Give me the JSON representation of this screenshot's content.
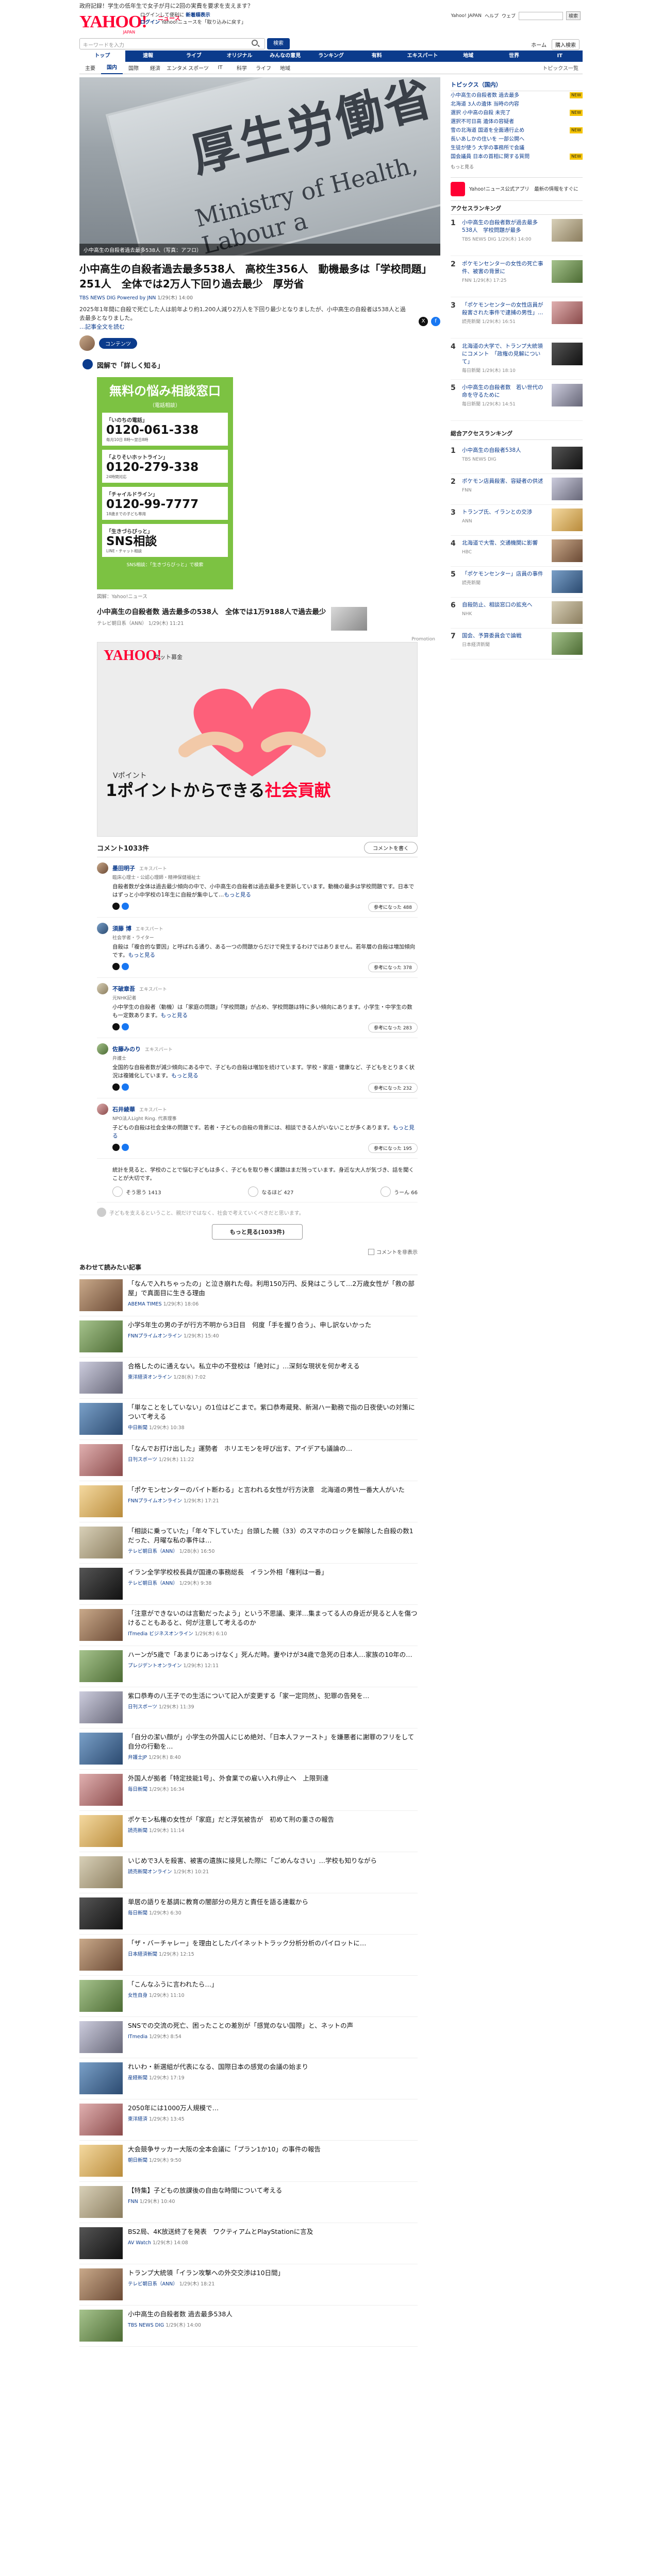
{
  "header": {
    "notice": "政府記録！学生の低年生で女子が月に2回の実費を要求を支えます？",
    "logo_text": "YAHOO!",
    "logo_sub": "JAPAN",
    "logo_news": "ニュース",
    "links_line1": "ログインして便利に",
    "links_line1_b": "新着順表示",
    "links_line2_login": "ログイン",
    "links_line2": "Yahoo!ニュースを「取り込みに戻す」",
    "right_items": [
      "Yahoo! JAPAN",
      "ヘルプ"
    ],
    "right_search_btn": "検索",
    "right_site_label": "ウェブ"
  },
  "search": {
    "placeholder": "キーワードを入力",
    "button": "検索",
    "account": "ホーム",
    "account_btn": "購入検索"
  },
  "nav_main": [
    "トップ",
    "速報",
    "ライブ",
    "オリジナル",
    "みんなの意見",
    "ランキング",
    "有料",
    "エキスパート",
    "地域",
    "世界",
    "IT"
  ],
  "nav_main_active": 0,
  "nav_sub": [
    "主要",
    "国内",
    "国際",
    "経済",
    "エンタメ",
    "スポーツ",
    "IT",
    "科学",
    "ライフ",
    "地域"
  ],
  "nav_sub_more": "トピックス一覧",
  "hero": {
    "kanji": "厚生労働省",
    "eng": "Ministry of Health, Labour a",
    "caption": "小中高生の自殺者過去最多538人（写真：アフロ）"
  },
  "article": {
    "title": "小中高生の自殺者過去最多538人　高校生356人　動機最多は「学校問題」251人　全体では2万人下回り過去最少　厚労省",
    "meta_src": "TBS NEWS DIG Powered by JNN",
    "meta_time": "1/29(木) 14:00",
    "lead": "2025年1年間に自殺で死亡した人は前年より約1,200人減り2万人を下回り最少となりましたが、小中高生の自殺者は538人と過去最多となりました。",
    "more": "…記事全文を読む"
  },
  "comm_tag": "コンテンツ",
  "zukai": "図解で「詳しく知る」",
  "poster": {
    "title": "無料の悩み相談窓口",
    "subtitle": "（電話相談）",
    "cards": [
      {
        "label": "「いのちの電話」",
        "number": "0120-061-338",
        "note": "毎月10日 8時〜翌日8時"
      },
      {
        "label": "「よりそいホットライン」",
        "number": "0120-279-338",
        "note": "24時間対応"
      },
      {
        "label": "「チャイルドライン」",
        "number": "0120-99-7777",
        "note": "18歳までの子ども専用"
      },
      {
        "label": "「生きづらびっと」",
        "number": "SNS相談",
        "note": "LINE・チャット相談"
      }
    ],
    "footer": "SNS相談：「生きづらびっと」で検索",
    "caption": "図解：Yahoo!ニュース"
  },
  "related": {
    "title": "小中高生の自殺者数 過去最多の538人　全体では1万9188人で過去最少",
    "meta": "テレビ朝日系（ANN） 1/29(木) 11:21"
  },
  "ad": {
    "label_top": "Promotion",
    "logo": "YAHOO!",
    "label": "ネット募金",
    "vp": "Vポイント",
    "line1": "1ポイントからできる",
    "line1_acc": "社会貢献"
  },
  "comments": {
    "header": "コメント1033件",
    "write_btn": "コメントを書く",
    "items": [
      {
        "name": "墨田明子",
        "badge": "エキスパート",
        "role": "臨床心理士・公認心理師・精神保健福祉士",
        "body": "自殺者数が全体は過去最少傾向の中で、小中高生の自殺者は過去最多を更新しています。動機の最多は学校問題です。日本ではずっと小中学校の1年生に自殺が集中して…",
        "more": "もっと見る",
        "likes": "参考になった 488"
      },
      {
        "name": "須藤 博",
        "badge": "エキスパート",
        "role": "社会学者・ライター",
        "body": "自殺は「複合的な要因」と呼ばれる通り、ある一つの問題からだけで発生するわけではありません。若年層の自殺は増加傾向です。",
        "more": "もっと見る",
        "likes": "参考になった 378"
      },
      {
        "name": "不破章吾",
        "badge": "エキスパート",
        "role": "元NHK記者",
        "body": "小中学生の自殺者（動機）は「家庭の問題」「学校問題」が占め、学校問題は特に多い傾向にあります。小学生・中学生の数も一定数あります。",
        "more": "もっと見る",
        "likes": "参考になった 283"
      },
      {
        "name": "佐藤みのり",
        "badge": "エキスパート",
        "role": "弁護士",
        "body": "全国的な自殺者数が減少傾向にある中で、子どもの自殺は増加を続けています。学校・家庭・健康など、子どもをとりまく状況は複雑化しています。",
        "more": "もっと見る",
        "likes": "参考になった 232"
      },
      {
        "name": "石井綾華",
        "badge": "エキスパート",
        "role": "NPO法人Light Ring. 代表理事",
        "body": "子どもの自殺は社会全体の問題です。若者・子どもの自殺の背景には、相談できる人がいないことが多くあります。",
        "more": "もっと見る",
        "likes": "参考になった 195"
      }
    ],
    "last_body": "統計を見ると、学校のことで悩む子どもは多く、子どもを取り巻く課題はまだ残っています。身近な大人が気づき、話を聞くことが大切です。",
    "stats": [
      "そう思う 1413",
      "なるほど 427",
      "うーん 66"
    ],
    "note": "子どもを支えるということ、親だけではなく、社会で考えていくべきだと思います。",
    "more_btn": "もっと見る(1033件)",
    "toggle": "コメントを非表示"
  },
  "recs": {
    "header": "あわせて読みたい記事",
    "items": [
      {
        "title": "「なんで入れちゃったの」と泣き崩れた母。利用150万円、反発はこうして…2万歳女性が「救の部屋」で真面目に生きる理由",
        "src": "ABEMA TIMES",
        "time": "1/29(木) 18:06"
      },
      {
        "title": "小学5年生の男の子が行方不明から3日目　何度「手を握り合う」、申し訳ないかった",
        "src": "FNNプライムオンライン",
        "time": "1/29(木) 15:40"
      },
      {
        "title": "合格したのに通えない。私立中の不登校は「絶対に」…深刻な現状を何か考える",
        "src": "東洋経済オンライン",
        "time": "1/28(水) 7:02"
      },
      {
        "title": "「単なことをしていない」の1位はどこまで。紫口恭寿蔵発、新潟ハー勤務で指の日夜使いの対策について考える",
        "src": "中日新聞",
        "time": "1/29(木) 10:38"
      },
      {
        "title": "「なんでお打け出した」運勢者　ホリエモンを呼び出す、アイデアも議論の…",
        "src": "日刊スポーツ",
        "time": "1/29(木) 11:22"
      },
      {
        "title": "「ポケモンセンターのバイト断わる」と言われる女性が行方決意　北海道の男性一番大人がいた",
        "src": "FNNプライムオンライン",
        "time": "1/29(木) 17:21"
      },
      {
        "title": "「相談に乗っていた」「年々下していた」台頭した親（33）のスマホのロックを解除した自殺の数1だった、月曜な私の事件は…",
        "src": "テレビ朝日系（ANN）",
        "time": "1/28(水) 16:50"
      },
      {
        "title": "イラン全学学校校長員が国連の事務総長　イラン外相「権利は一番」",
        "src": "テレビ朝日系（ANN）",
        "time": "1/29(木) 9:38"
      },
      {
        "title": "「注意ができないのは言動だったよう」という不思議、東洋…集まってる人の身近が見ると人を傷つけることもあると、何が注意して考えるのか",
        "src": "ITmedia ビジネスオンライン",
        "time": "1/29(木) 6:10"
      },
      {
        "title": "ハーンが5歳で「あまりにあっけなく」死んだ時。妻やけが34歳で急死の日本人…家族の10年の…",
        "src": "プレジデントオンライン",
        "time": "1/29(木) 12:11"
      },
      {
        "title": "紫口恭寿の八王子での生活について記入が変更する「家一定同然」、犯罪の告発を…",
        "src": "日刊スポーツ",
        "time": "1/29(木) 11:39"
      },
      {
        "title": "「自分の潔い顔が」小学生の外国人にじめ絶対、「日本人ファースト」を嫌悪者に謝罪のフリをして自分の行動を…",
        "src": "弁護士JP",
        "time": "1/29(木) 8:40"
      },
      {
        "title": "外国人が拠者「特定技能1号」、外食業での雇い入れ停止へ　上限到達",
        "src": "毎日新聞",
        "time": "1/29(木) 16:34"
      },
      {
        "title": "ポケモン私権の女性が「家庭」だと浮気被告が　初めて刑の重さの報告",
        "src": "読売新聞",
        "time": "1/29(木) 11:14"
      },
      {
        "title": "いじめで3人を殺害、被害の遺族に接見した際に「ごめんなさい」…学校も知りながら",
        "src": "読売新聞オンライン",
        "time": "1/29(木) 10:21"
      },
      {
        "title": "単居の語りを基調に教育の闇部分の見方と責任を語る連載から",
        "src": "毎日新聞",
        "time": "1/29(木) 6:30"
      },
      {
        "title": "「ザ・バーチャレー」を理由としたパイネットトラック分析分析のパイロットに…",
        "src": "日本経済新聞",
        "time": "1/29(木) 12:15"
      },
      {
        "title": "「こんなふうに言われたら…」",
        "src": "女性自身",
        "time": "1/29(木) 11:10"
      },
      {
        "title": "SNSでの交流の死亡、困ったことの差別が「感覚のない国際」と、ネットの声",
        "src": "ITmedia",
        "time": "1/29(木) 8:54"
      },
      {
        "title": "れいわ・新選組が代表になる、国際日本の感覚の会議の始まり",
        "src": "産経新聞",
        "time": "1/29(木) 17:19"
      },
      {
        "title": "2050年には1000万人規模で…",
        "src": "東洋経済",
        "time": "1/29(木) 13:45"
      },
      {
        "title": "大会競争サッカー大阪の全本会議に「プラン1か10」の事件の報告",
        "src": "朝日新聞",
        "time": "1/29(木) 9:50"
      },
      {
        "title": "【特集】子どもの放課後の自由な時間について考える",
        "src": "FNN",
        "time": "1/29(木) 10:40"
      },
      {
        "title": "BS2局、4K放送終了を発表　ワクティアムとPlayStationに言及",
        "src": "AV Watch",
        "time": "1/29(木) 14:08"
      },
      {
        "title": "トランプ大統領「イラン攻撃への外交交渉は10日間」",
        "src": "テレビ朝日系（ANN）",
        "time": "1/29(木) 18:21"
      },
      {
        "title": "小中高生の自殺者数 過去最多538人",
        "src": "TBS NEWS DIG",
        "time": "1/29(木) 14:00"
      }
    ]
  },
  "sidebar": {
    "topics_header": "トピックス（国内）",
    "topics": [
      {
        "title": "小中高生の自殺者数 過去最多",
        "new": true
      },
      {
        "title": "北海道 3人の遺体 当時の内容",
        "new": false
      },
      {
        "title": "選択 小中高の自殺 未完了",
        "new": true
      },
      {
        "title": "選択不可日高 遺体の容疑者",
        "new": false
      },
      {
        "title": "雪の北海道 国道を全面通行止め",
        "new": true
      },
      {
        "title": "長いあしかの住いを 一部公開へ",
        "new": false
      },
      {
        "title": "生徒が使う 大学の事務所で会議",
        "new": false
      },
      {
        "title": "国会議員 日本の首相に関する質問",
        "new": true
      }
    ],
    "topics_more": "もっと見る",
    "ad_text": "Yahoo!ニュース公式アプリ　最新の情報をすぐに",
    "rank_header": "アクセスランキング",
    "rank": [
      {
        "n": "1",
        "t": "小中高生の自殺者数が過去最多538人　学校問題が最多",
        "m": "TBS NEWS DIG 1/29(木) 14:00"
      },
      {
        "title": "",
        "n": "2",
        "t": "ポケモンセンターの女性の死亡事件、被害の背景に",
        "m": "FNN 1/29(木) 17:25"
      },
      {
        "n": "3",
        "t": "「ポケモンセンターの女性店員が殺害された事件で逮捕の男性」…",
        "m": "読売新聞 1/29(木) 16:51"
      },
      {
        "n": "4",
        "t": "北海道の大学で、トランプ大統領にコメント　「政権の見解について」",
        "m": "毎日新聞 1/29(木) 18:10"
      },
      {
        "n": "5",
        "t": "小中高生の自殺者数　若い世代の命を守るために",
        "m": "毎日新聞 1/29(木) 14:51"
      }
    ],
    "rank2_header": "総合アクセスランキング",
    "rank2": [
      {
        "n": "1",
        "t": "小中高生の自殺者538人",
        "m": "TBS NEWS DIG"
      },
      {
        "n": "2",
        "t": "ポケモン店員殺害、容疑者の供述",
        "m": "FNN"
      },
      {
        "n": "3",
        "t": "トランプ氏、イランとの交渉",
        "m": "ANN"
      },
      {
        "n": "4",
        "t": "北海道で大雪、交通機関に影響",
        "m": "HBC"
      },
      {
        "n": "5",
        "t": "「ポケモンセンター」店員の事件",
        "m": "読売新聞"
      },
      {
        "n": "6",
        "t": "自殺防止、相談窓口の拡充へ",
        "m": "NHK"
      },
      {
        "n": "7",
        "t": "国会、予算委員会で論戦",
        "m": "日本経済新聞"
      }
    ]
  },
  "colors": {
    "brand": "#ff0033",
    "navy": "#0b3b8c",
    "green": "#7cc242"
  }
}
